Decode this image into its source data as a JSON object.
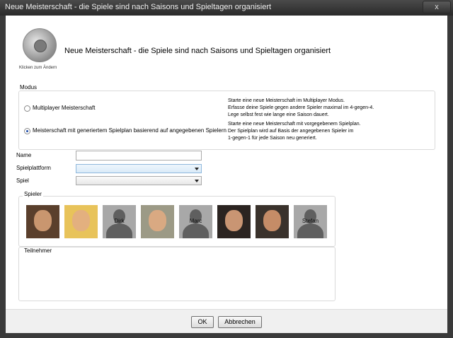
{
  "window": {
    "title": "Neue Meisterschaft - die Spiele sind nach Saisons und Spieltagen organisiert",
    "close_label": "x"
  },
  "header": {
    "logo_caption": "Klicken zum Ändern",
    "title": "Neue Meisterschaft - die Spiele sind nach Saisons und Spieltagen organisiert"
  },
  "modus": {
    "label": "Modus",
    "options": [
      {
        "label": "Multiplayer Meisterschaft",
        "selected": false,
        "description": [
          "Starte eine neue Meisterschaft im Multiplayer Modus.",
          "Erfasse deine Spiele gegen andere Spieler maximal im 4-gegen-4.",
          "Lege selbst fest wie lange eine Saison dauert."
        ]
      },
      {
        "label": "Meisterschaft mit generiertem Spielplan basierend auf angegebenen Spielern",
        "selected": true,
        "description": [
          "Starte eine neue Meisterschaft mit vorgegebenem Spielplan.",
          "Der Spielplan wird auf Basis der angegebenen Spieler im",
          "1-gegen-1 für jede Saison neu generiert."
        ]
      }
    ]
  },
  "form": {
    "name_label": "Name",
    "name_value": "",
    "platform_label": "Spielplattform",
    "platform_value": "",
    "game_label": "Spiel",
    "game_value": ""
  },
  "players": {
    "label": "Spieler",
    "items": [
      {
        "name": "",
        "kind": "photo",
        "skin": "#c9966f",
        "bg": "#5a3f2c"
      },
      {
        "name": "",
        "kind": "photo",
        "skin": "#e3b07f",
        "bg": "#e8c35a"
      },
      {
        "name": "Dirk",
        "kind": "silhouette"
      },
      {
        "name": "",
        "kind": "photo",
        "skin": "#d9a982",
        "bg": "#9c9a86"
      },
      {
        "name": "Marc",
        "kind": "silhouette"
      },
      {
        "name": "",
        "kind": "photo",
        "skin": "#c99573",
        "bg": "#2b2421"
      },
      {
        "name": "",
        "kind": "photo",
        "skin": "#c58c67",
        "bg": "#3a322c"
      },
      {
        "name": "Stefan",
        "kind": "silhouette"
      }
    ]
  },
  "participants": {
    "label": "Teilnehmer"
  },
  "footer": {
    "ok_label": "OK",
    "cancel_label": "Abbrechen"
  }
}
